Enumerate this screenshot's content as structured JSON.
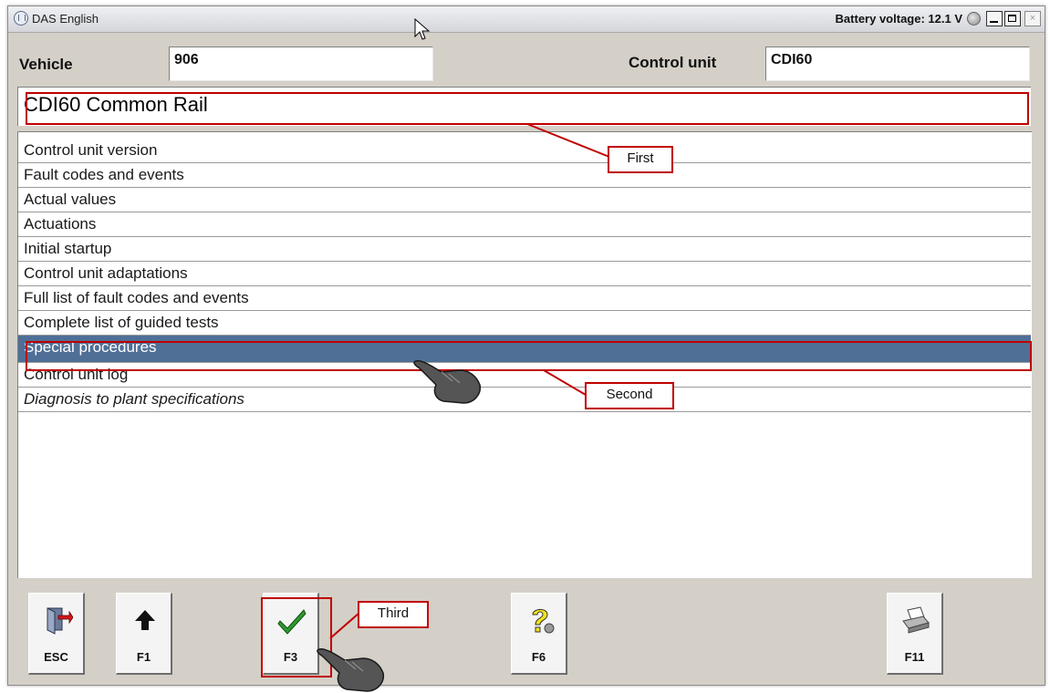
{
  "window": {
    "title": "DAS English",
    "battery_label": "Battery voltage: 12.1 V",
    "min_label": "",
    "max_label": "",
    "close_label": "×"
  },
  "header": {
    "vehicle_label": "Vehicle",
    "vehicle_value": "906",
    "control_unit_label": "Control unit",
    "control_unit_value": "CDI60"
  },
  "panel": {
    "title": "CDI60 Common Rail"
  },
  "menu": {
    "items": [
      {
        "label": "Control unit version"
      },
      {
        "label": "Fault codes and events"
      },
      {
        "label": "Actual values"
      },
      {
        "label": "Actuations"
      },
      {
        "label": "Initial startup"
      },
      {
        "label": "Control unit adaptations"
      },
      {
        "label": "Full list of fault codes and events"
      },
      {
        "label": "Complete list of guided tests"
      },
      {
        "label": "Special procedures",
        "selected": true
      },
      {
        "label": "Control unit log"
      },
      {
        "label": "Diagnosis to plant specifications",
        "italic": true
      }
    ],
    "selected_color": "#4f6f97"
  },
  "toolbar": {
    "esc": "ESC",
    "f1": "F1",
    "f3": "F3",
    "f6": "F6",
    "f11": "F11"
  },
  "annotations": {
    "first": "First",
    "second": "Second",
    "third": "Third",
    "color": "#c00000"
  }
}
